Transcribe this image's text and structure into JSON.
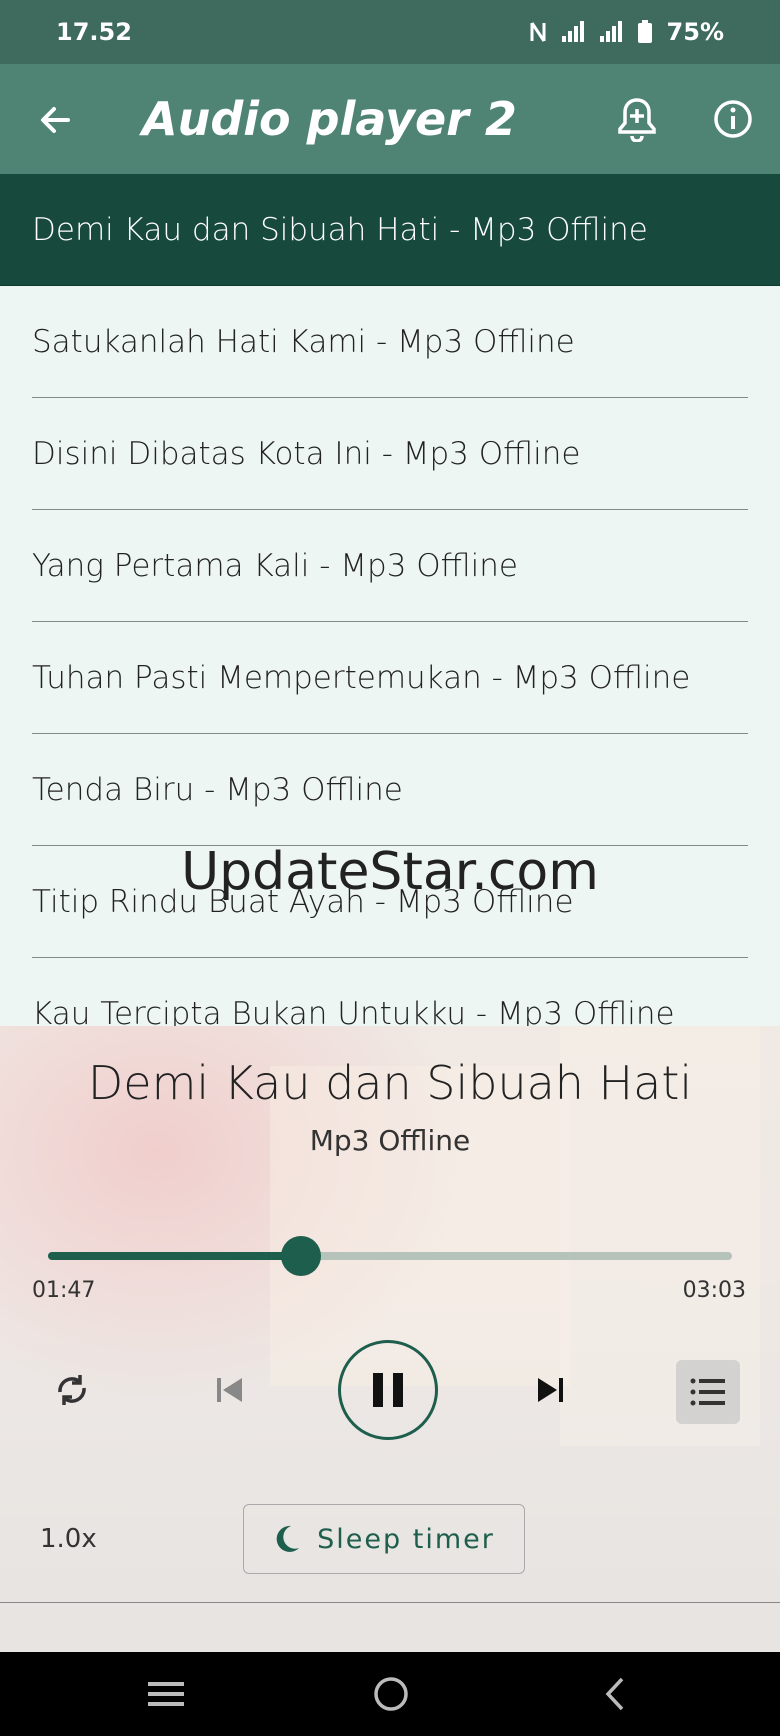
{
  "status_bar": {
    "time": "17.52",
    "battery": "75%"
  },
  "app_bar": {
    "title": "Audio player 2"
  },
  "playlist": [
    {
      "label": "Demi Kau dan Sibuah Hati - Mp3 Offline",
      "active": true
    },
    {
      "label": "Satukanlah Hati Kami - Mp3 Offline"
    },
    {
      "label": "Disini Dibatas Kota Ini - Mp3 Offline"
    },
    {
      "label": "Yang Pertama Kali - Mp3 Offline"
    },
    {
      "label": "Tuhan Pasti Mempertemukan - Mp3 Offline"
    },
    {
      "label": "Tenda Biru - Mp3 Offline"
    },
    {
      "label": "Titip Rindu Buat Ayah - Mp3 Offline"
    },
    {
      "label": "Kau Tercipta Bukan Untukku - Mp3 Offline"
    }
  ],
  "watermark": "UpdateStar.com",
  "now_playing": {
    "title": "Demi Kau dan Sibuah Hati",
    "subtitle": "Mp3 Offline",
    "current_time": "01:47",
    "total_time": "03:03",
    "progress": 0.37
  },
  "controls": {
    "speed": "1.0x",
    "sleep_timer": "Sleep timer"
  },
  "colors": {
    "accent": "#1d5e4d",
    "app_bar": "#4f8474",
    "status_bar": "#3f6b5e",
    "active_row": "#174a3d"
  }
}
